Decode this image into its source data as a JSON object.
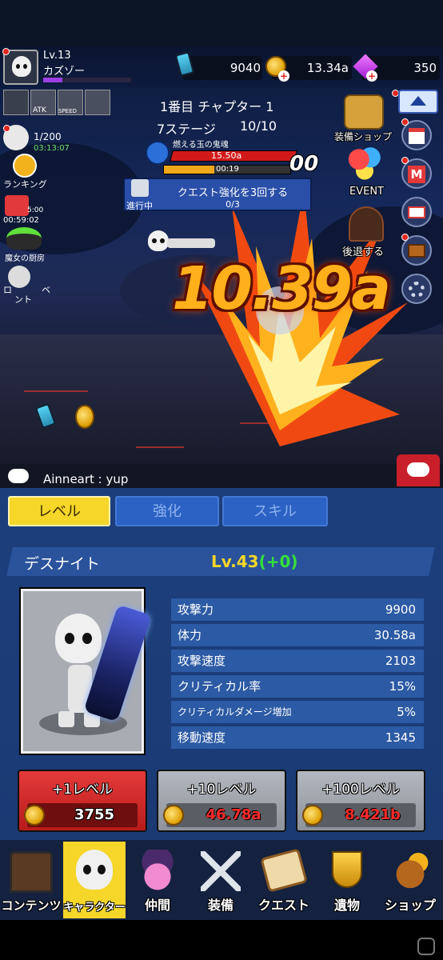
{
  "player": {
    "level": "Lv.13",
    "name": "カズゾー"
  },
  "currency": {
    "battery": "9040",
    "gold": "13.34a",
    "gems": "350"
  },
  "buffs": {
    "atk": "ATK",
    "speed": "SPEED"
  },
  "stage": {
    "chapter": "1番目 チャプター 1",
    "stage": "7ステージ",
    "progress": "10/10"
  },
  "boss": {
    "name": "燃える玉の鬼魂",
    "hp": "15.50a",
    "timer": "00:19",
    "combo": "00"
  },
  "quest": {
    "title": "クエスト強化を3回する",
    "progress": "0/3",
    "status": "進行中"
  },
  "left_menu": {
    "counter": "1/200",
    "timer1": "03:13:07",
    "ranking": "ランキング",
    "timer2": "00:59:02",
    "video_count": "5:00",
    "kitchen": "魔女の厨房",
    "event_partial": "ロ",
    "event_partial2": "ベ",
    "event_partial3": "ント"
  },
  "right_menu": {
    "shop": "装備ショップ",
    "event": "EVENT",
    "retreat": "後退する",
    "mail_badge": "M"
  },
  "damage": "10.39a",
  "chat": {
    "message": "Ainneart : yup"
  },
  "tabs": {
    "level": "レベル",
    "upgrade": "強化",
    "skill": "スキル"
  },
  "character": {
    "name": "デスナイト",
    "level": "Lv.43",
    "bonus": "(+0)"
  },
  "stats": [
    {
      "label": "攻撃力",
      "value": "9900"
    },
    {
      "label": "体力",
      "value": "30.58a"
    },
    {
      "label": "攻撃速度",
      "value": "2103"
    },
    {
      "label": "クリティカル率",
      "value": "15%"
    },
    {
      "label": "クリティカルダメージ増加",
      "value": "5%"
    },
    {
      "label": "移動速度",
      "value": "1345"
    }
  ],
  "buttons": [
    {
      "label": "+1レベル",
      "cost": "3755"
    },
    {
      "label": "+10レベル",
      "cost": "46.78a"
    },
    {
      "label": "+100レベル",
      "cost": "8.421b"
    }
  ],
  "nav": [
    "コンテンツ",
    "キャラクター",
    "仲間",
    "装備",
    "クエスト",
    "遺物",
    "ショップ"
  ],
  "colors": {
    "accent_yellow": "#f5d629",
    "panel_blue": "#1c3f7c",
    "red_button": "#d82b2b",
    "grey_button": "#9a9ea6",
    "bonus_green": "#37e03a",
    "cost_red": "#ff2a2a"
  }
}
